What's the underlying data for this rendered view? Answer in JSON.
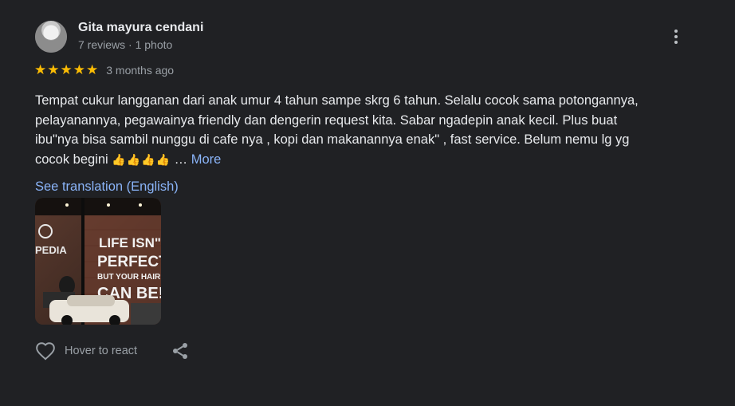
{
  "reviewer": {
    "name": "Gita mayura cendani",
    "meta": "7 reviews · 1 photo",
    "avatar_icon": "avatar-photo"
  },
  "review": {
    "rating": 5,
    "star_glyph": "★",
    "star_color": "#fbbc04",
    "date": "3 months ago",
    "lines": [
      "Tempat cukur langganan dari anak umur 4 tahun sampe skrg 6 tahun. Selalu cocok sama potongannya,",
      "pelayanannya, pegawainya friendly dan dengerin request kita. Sabar ngadepin anak kecil. Plus buat",
      "ibu\"nya bisa sambil nunggu di cafe nya , kopi dan makanannya enak\" , fast service. Belum nemu lg yg",
      "cocok begini"
    ],
    "emoji": "👍👍👍👍",
    "ellipsis": " …",
    "more_label": "More",
    "translation_label": "See translation (English)"
  },
  "photo": {
    "sign_left": "PEDIA",
    "window_lines": [
      "LIFE ISN\"T",
      "PERFECT",
      "BUT YOUR HAIR",
      "CAN BE!"
    ]
  },
  "actions": {
    "react_label": "Hover to react",
    "react_icon": "heart-outline-icon",
    "share_icon": "share-icon"
  },
  "colors": {
    "background": "#202124",
    "text_primary": "#e8eaed",
    "text_secondary": "#9aa0a6",
    "link": "#8ab4f8"
  }
}
